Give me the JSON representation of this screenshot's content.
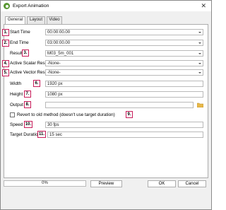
{
  "window": {
    "title": "Export Animation"
  },
  "tabs": [
    {
      "label": "General",
      "active": true
    },
    {
      "label": "Layout",
      "active": false
    },
    {
      "label": "Video",
      "active": false
    }
  ],
  "fields": {
    "start_time": {
      "badge": "1.",
      "label": "Start Time",
      "value": "00:00:00.00"
    },
    "end_time": {
      "badge": "2.",
      "label": "End Time",
      "value": "03:00:00.00"
    },
    "result": {
      "badge": "3.",
      "label": "Result",
      "value": "M03_5m_001"
    },
    "active_scalar": {
      "badge": "4.",
      "label": "Active Scalar Result",
      "value": "-None-"
    },
    "active_vector": {
      "badge": "5.",
      "label": "Active Vector Result",
      "value": "-None-"
    },
    "width": {
      "badge": "6.",
      "label": "Width",
      "value": "1920 px"
    },
    "height": {
      "badge": "7.",
      "label": "Height",
      "value": "1080 px"
    },
    "output": {
      "badge": "8.",
      "label": "Output",
      "value": ""
    },
    "revert": {
      "badge": "9.",
      "label": "Revert to old method (doesn't use target duration)",
      "checked": false
    },
    "speed": {
      "badge": "10.",
      "label": "Speed",
      "value": "30 fps"
    },
    "target_duration": {
      "badge": "11.",
      "label": "Target Duration",
      "value": "15 sec"
    }
  },
  "footer": {
    "progress": "0%",
    "preview_label": "Preview",
    "ok_label": "OK",
    "cancel_label": "Cancel"
  },
  "colors": {
    "badge_border": "#c81c5a",
    "qgis_green": "#589632"
  }
}
